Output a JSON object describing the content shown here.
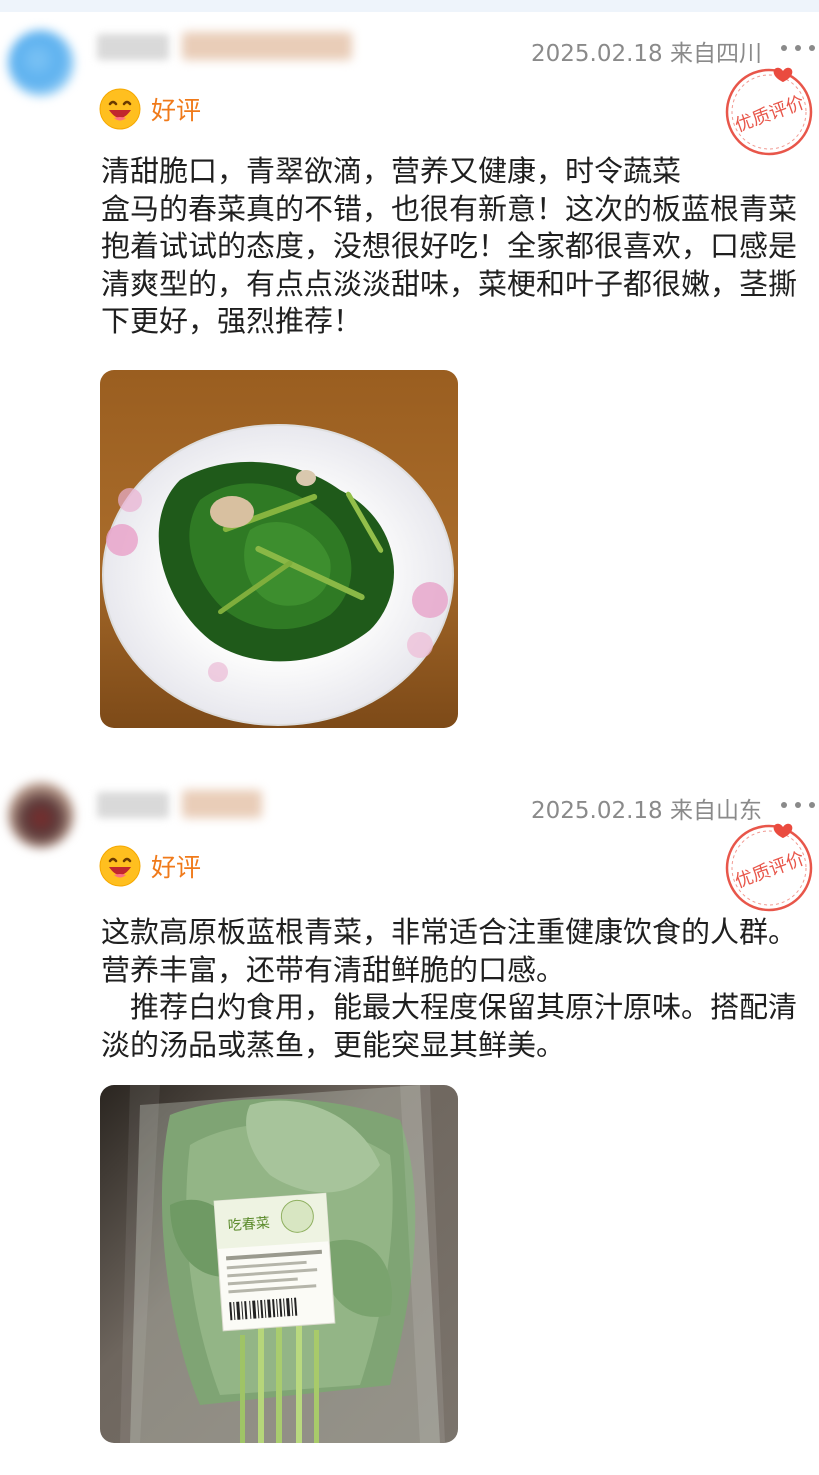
{
  "reviews": [
    {
      "date_location": "2025.02.18 来自四川",
      "rating_label": "好评",
      "badge_text": "优质评价",
      "text": "清甜脆口，青翠欲滴，营养又健康，时令蔬菜\n盒马的春菜真的不错，也很有新意！这次的板蓝根青菜抱着试试的态度，没想很好吃！全家都很喜欢，口感是清爽型的，有点点淡淡甜味，菜梗和叶子都很嫩，茎撕下更好，强烈推荐！",
      "photo_icon": "plate-of-greens-photo"
    },
    {
      "date_location": "2025.02.18 来自山东",
      "rating_label": "好评",
      "badge_text": "优质评价",
      "text": "这款高原板蓝根青菜，非常适合注重健康饮食的人群。营养丰富，还带有清甜鲜脆的口感。\n　推荐白灼食用，能最大程度保留其原汁原味。搭配清淡的汤品或蒸鱼，更能突显其鲜美。",
      "photo_icon": "packaged-greens-photo",
      "package_label": "吃春菜"
    }
  ],
  "colors": {
    "rating_orange": "#f07a1a",
    "stamp_red": "#e8564a",
    "meta_gray": "#8a8a8a"
  },
  "icons": {
    "rating": "smile-face-icon",
    "more": "more-dots-icon",
    "badge": "quality-review-stamp-icon"
  }
}
